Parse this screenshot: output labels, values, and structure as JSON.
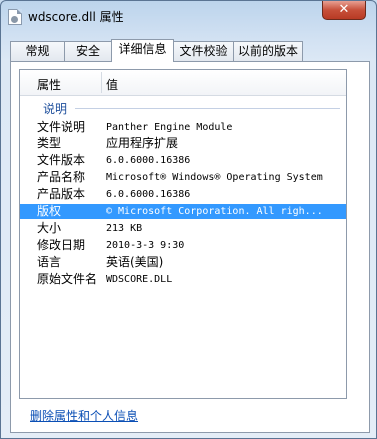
{
  "window": {
    "title": "wdscore.dll 属性",
    "close_glyph": "✕"
  },
  "tabs": [
    {
      "label": "常规"
    },
    {
      "label": "安全"
    },
    {
      "label": "详细信息"
    },
    {
      "label": "文件校验"
    },
    {
      "label": "以前的版本"
    }
  ],
  "active_tab": "详细信息",
  "list": {
    "col_property": "属性",
    "col_value": "值",
    "group_label": "说明",
    "rows": [
      {
        "key": "文件说明",
        "value": "Panther Engine Module"
      },
      {
        "key": "类型",
        "value": "应用程序扩展"
      },
      {
        "key": "文件版本",
        "value": "6.0.6000.16386"
      },
      {
        "key": "产品名称",
        "value": "Microsoft® Windows® Operating System"
      },
      {
        "key": "产品版本",
        "value": "6.0.6000.16386"
      },
      {
        "key": "版权",
        "value": "© Microsoft Corporation. All righ..."
      },
      {
        "key": "大小",
        "value": "213 KB"
      },
      {
        "key": "修改日期",
        "value": "2010-3-3 9:30"
      },
      {
        "key": "语言",
        "value": "英语(美国)"
      },
      {
        "key": "原始文件名",
        "value": "WDSCORE.DLL"
      }
    ],
    "selected_row": "版权"
  },
  "footer": {
    "link": "删除属性和个人信息"
  },
  "colors": {
    "selection": "#3399ff",
    "link": "#0b4fb5",
    "group": "#1e4f9c"
  }
}
